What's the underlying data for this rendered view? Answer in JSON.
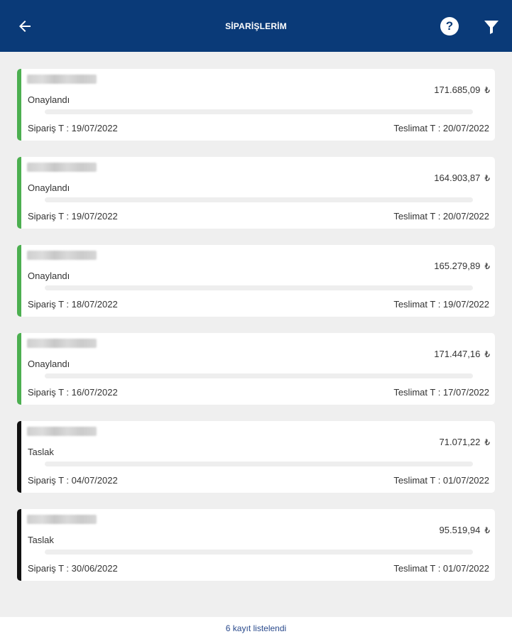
{
  "header": {
    "title": "SİPARİŞLERİM",
    "back_icon": "arrow-left-icon",
    "help_icon": "help-circle-icon",
    "help_glyph": "?",
    "filter_icon": "filter-icon",
    "background_color": "#0a3a78"
  },
  "status_colors": {
    "Onaylandı": "#4caf50",
    "Taslak": "#111111"
  },
  "orders": [
    {
      "status": "Onaylandı",
      "amount": "171.685,09",
      "currency": "₺",
      "order_date": "Sipariş T : 19/07/2022",
      "delivery_date": "Teslimat T : 20/07/2022",
      "accent_color": "#4caf50",
      "progress": 0
    },
    {
      "status": "Onaylandı",
      "amount": "164.903,87",
      "currency": "₺",
      "order_date": "Sipariş T : 19/07/2022",
      "delivery_date": "Teslimat T : 20/07/2022",
      "accent_color": "#4caf50",
      "progress": 0
    },
    {
      "status": "Onaylandı",
      "amount": "165.279,89",
      "currency": "₺",
      "order_date": "Sipariş T : 18/07/2022",
      "delivery_date": "Teslimat T : 19/07/2022",
      "accent_color": "#4caf50",
      "progress": 0
    },
    {
      "status": "Onaylandı",
      "amount": "171.447,16",
      "currency": "₺",
      "order_date": "Sipariş T : 16/07/2022",
      "delivery_date": "Teslimat T : 17/07/2022",
      "accent_color": "#4caf50",
      "progress": 0
    },
    {
      "status": "Taslak",
      "amount": "71.071,22",
      "currency": "₺",
      "order_date": "Sipariş T : 04/07/2022",
      "delivery_date": "Teslimat T : 01/07/2022",
      "accent_color": "#111111",
      "progress": 0
    },
    {
      "status": "Taslak",
      "amount": "95.519,94",
      "currency": "₺",
      "order_date": "Sipariş T : 30/06/2022",
      "delivery_date": "Teslimat T : 01/07/2022",
      "accent_color": "#111111",
      "progress": 0
    }
  ],
  "footer": {
    "record_count_text": "6 kayıt listelendi"
  }
}
